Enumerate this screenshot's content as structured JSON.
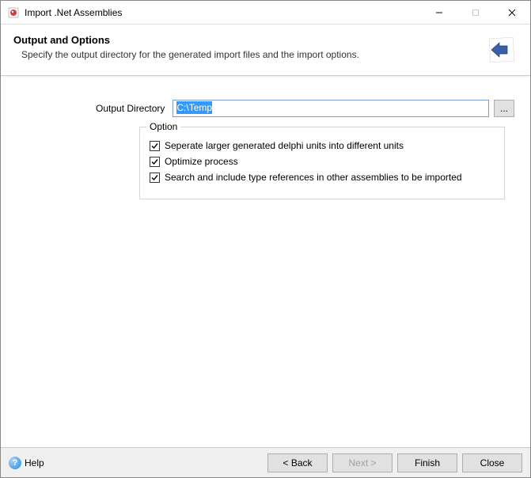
{
  "window": {
    "title": "Import .Net Assemblies"
  },
  "header": {
    "title": "Output and Options",
    "subtitle": "Specify the output directory for the generated import files and the import options."
  },
  "outputDir": {
    "label": "Output Directory",
    "value": "C:\\Temp",
    "browse": "..."
  },
  "optionGroup": {
    "legend": "Option",
    "items": [
      {
        "label": "Seperate larger generated delphi units into different units",
        "checked": true
      },
      {
        "label": "Optimize process",
        "checked": true
      },
      {
        "label": "Search and include type references in other assemblies to be imported",
        "checked": true
      }
    ]
  },
  "footer": {
    "help": "Help",
    "back": "< Back",
    "next": "Next >",
    "finish": "Finish",
    "close": "Close"
  }
}
